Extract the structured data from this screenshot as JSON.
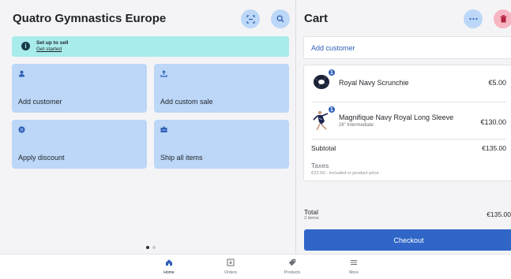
{
  "left": {
    "title": "Quatro Gymnastics Europe",
    "banner": {
      "title": "Set up to sell",
      "link": "Get started"
    },
    "tiles": [
      {
        "label": "Add customer",
        "icon": "person-icon"
      },
      {
        "label": "Add custom sale",
        "icon": "upload-icon"
      },
      {
        "label": "Apply discount",
        "icon": "discount-icon"
      },
      {
        "label": "Ship all items",
        "icon": "shipping-icon"
      }
    ]
  },
  "cart": {
    "title": "Cart",
    "add_customer": "Add customer",
    "items": [
      {
        "name": "Royal Navy Scrunchie",
        "variant": "",
        "price": "€5.00",
        "qty": "1"
      },
      {
        "name": "Magnifique Navy Royal Long Sleeve",
        "variant": "26\" Intermediate",
        "price": "€130.00",
        "qty": "1"
      }
    ],
    "subtotal_label": "Subtotal",
    "subtotal_value": "€135.00",
    "taxes_label": "Taxes",
    "taxes_detail": "€22.50 - included in product price",
    "total_label": "Total",
    "total_items": "2 items",
    "total_value": "€135.00",
    "checkout": "Checkout"
  },
  "nav": [
    {
      "label": "Home",
      "icon": "home-icon"
    },
    {
      "label": "Orders",
      "icon": "orders-icon"
    },
    {
      "label": "Products",
      "icon": "tag-icon"
    },
    {
      "label": "More",
      "icon": "menu-icon"
    }
  ],
  "colors": {
    "accent": "#2f66c7",
    "tile": "#bcd7f7",
    "banner": "#a8ecec",
    "delete": "#f7b6c2"
  }
}
